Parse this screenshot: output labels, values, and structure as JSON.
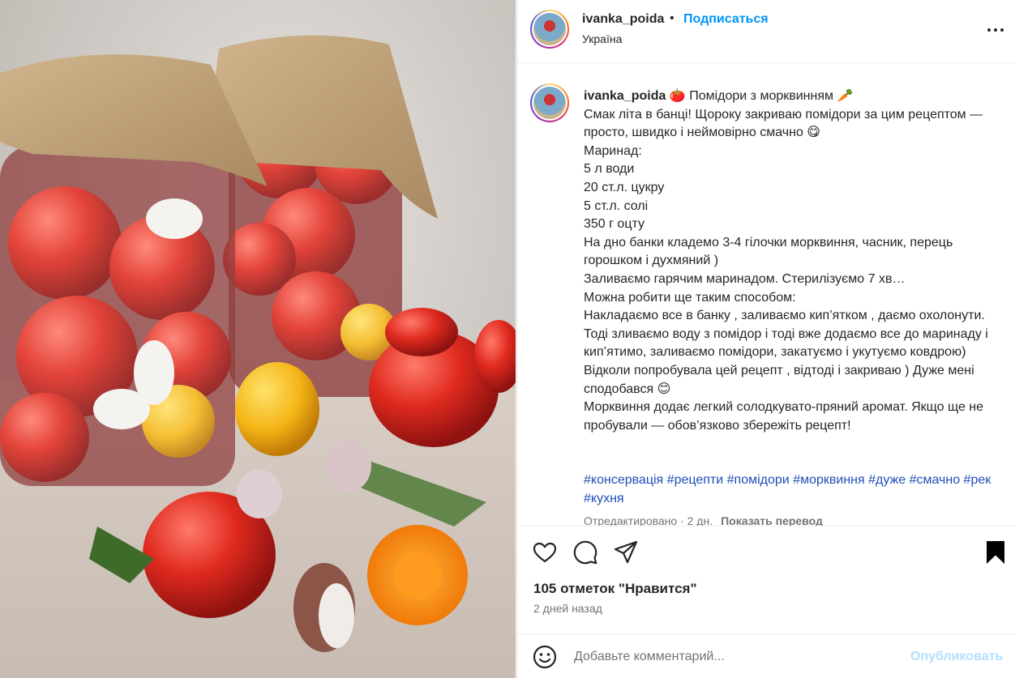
{
  "post": {
    "username": "ivanka_poida",
    "separator": "•",
    "follow_label": "Подписаться",
    "location": "Україна"
  },
  "caption": {
    "username": "ivanka_poida",
    "text": " 🍅 Помідори з морквинням 🥕\nСмак літа в банці! Щороку закриваю помідори за цим рецептом — просто, швидко і неймовірно смачно 😋\nМаринад:\n5 л води\n20 ст.л. цукру\n5 ст.л. солі\n350 г оцту\nНа дно банки кладемо 3-4 гілочки морквиння, часник, перець горошком і духмяний )\nЗаливаємо гарячим маринадом. Стерилізуємо 7 хв…\nМожна робити ще таким способом:\nНакладаємо все в банку , заливаємо кип’ятком , даємо охолонути. Тоді зливаємо воду з помідор і тоді вже додаємо все до маринаду і кип’ятимо, заливаємо помідори, закатуємо і укутуємо ковдрою)\nВідколи попробувала цей рецепт , відтоді і закриваю ) Дуже мені сподобався 😊\nМорквиння додає легкий солодкувато-пряний аромат. Якщо ще не пробували — обов’язково збережіть рецепт!",
    "hashtags": [
      "#консервація",
      "#рецепти",
      "#помідори",
      "#морквиння",
      "#дуже",
      "#смачно",
      "#рек",
      "#кухня"
    ],
    "edited": "Отредактировано · 2 дн.",
    "translate_label": "Показать перевод"
  },
  "stats": {
    "likes": "105 отметок \"Нравится\"",
    "time": "2 дней назад"
  },
  "comment": {
    "placeholder": "Добавьте комментарий...",
    "publish_label": "Опубликовать"
  },
  "icons": {
    "like": "heart-icon",
    "comment": "comment-bubble-icon",
    "share": "paper-plane-icon",
    "save": "bookmark-icon",
    "emoji": "smiley-icon",
    "more": "more-options-icon"
  },
  "colors": {
    "link_blue": "#0095f6",
    "publish_disabled": "#b2dffc",
    "meta_gray": "#737373"
  }
}
